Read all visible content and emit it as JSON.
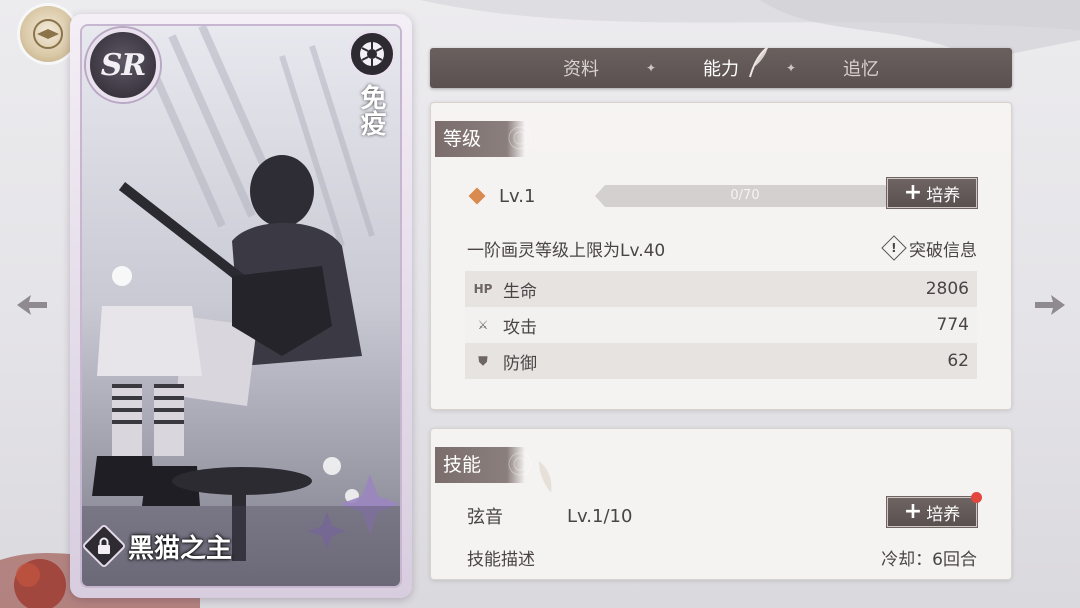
{
  "card": {
    "rarity": "SR",
    "attribute": "免疫",
    "name": "黑猫之主"
  },
  "tabs": [
    {
      "label": "资料",
      "active": false
    },
    {
      "label": "能力",
      "active": true
    },
    {
      "label": "追忆",
      "active": false
    }
  ],
  "level_section": {
    "title": "等级",
    "level": "Lv.1",
    "xp_text": "0/70",
    "xp_fraction": 0,
    "cultivate_label": "培养",
    "limit_text": "一阶画灵等级上限为Lv.40",
    "breakthrough_label": "突破信息",
    "stats": [
      {
        "icon": "hp-icon",
        "icon_text": "HP",
        "name": "生命",
        "value": "2806"
      },
      {
        "icon": "attack-icon",
        "icon_text": "⚔",
        "name": "攻击",
        "value": "774"
      },
      {
        "icon": "defense-icon",
        "icon_text": "⛊",
        "name": "防御",
        "value": "62"
      }
    ]
  },
  "skill_section": {
    "title": "技能",
    "skill_name": "弦音",
    "skill_level": "Lv.1/10",
    "cultivate_label": "培养",
    "has_notification": true,
    "desc_label": "技能描述",
    "cooldown": "冷却：6回合"
  },
  "colors": {
    "accent": "#d98a4f",
    "button": "#5f5554",
    "notification": "#e2463e"
  }
}
